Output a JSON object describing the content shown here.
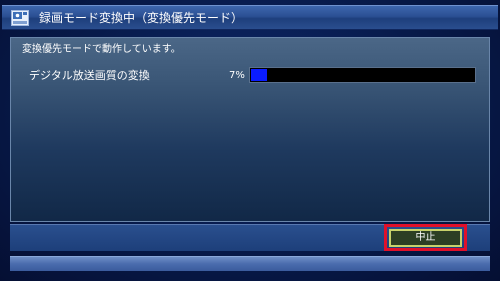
{
  "window": {
    "title": "録画モード変換中（変換優先モード）",
    "icon": "recorder-icon"
  },
  "status": {
    "message": "変換優先モードで動作しています。"
  },
  "task": {
    "label": "デジタル放送画質の変換",
    "percent_text": "7%",
    "progress": 0.07
  },
  "footer": {
    "stop_label": "中止"
  },
  "colors": {
    "progress_fill": "#0a1cff",
    "highlight": "#e0102a",
    "button_border": "#c8d26a"
  }
}
